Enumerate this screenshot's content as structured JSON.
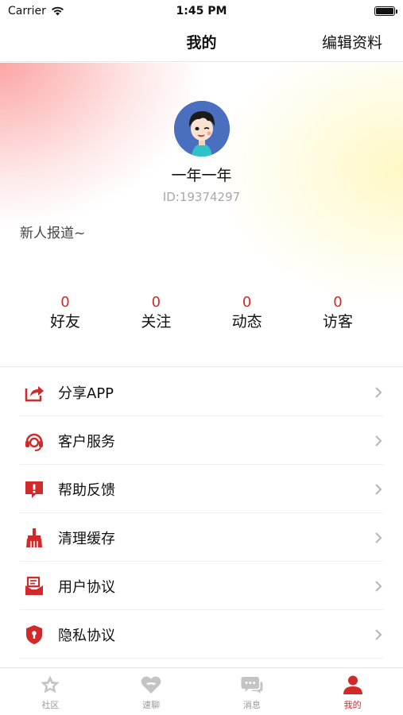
{
  "status_bar": {
    "carrier": "Carrier",
    "time": "1:45 PM"
  },
  "nav": {
    "title": "我的",
    "edit_label": "编辑资料"
  },
  "profile": {
    "username": "一年一年",
    "user_id": "ID:19374297",
    "bio": "新人报道~",
    "stats": [
      {
        "value": "0",
        "label": "好友"
      },
      {
        "value": "0",
        "label": "关注"
      },
      {
        "value": "0",
        "label": "动态"
      },
      {
        "value": "0",
        "label": "访客"
      }
    ]
  },
  "menu": [
    {
      "label": "分享APP",
      "icon": "share-icon"
    },
    {
      "label": "客户服务",
      "icon": "headset-icon"
    },
    {
      "label": "帮助反馈",
      "icon": "feedback-icon"
    },
    {
      "label": "清理缓存",
      "icon": "broom-icon"
    },
    {
      "label": "用户协议",
      "icon": "document-icon"
    },
    {
      "label": "隐私协议",
      "icon": "shield-icon"
    }
  ],
  "tabs": [
    {
      "label": "社区",
      "icon": "star-icon",
      "active": false
    },
    {
      "label": "速聊",
      "icon": "heart-icon",
      "active": false
    },
    {
      "label": "消息",
      "icon": "chat-icon",
      "active": false
    },
    {
      "label": "我的",
      "icon": "user-icon",
      "active": true
    }
  ],
  "colors": {
    "accent": "#d02a2a",
    "inactive": "#c4c4c4"
  }
}
